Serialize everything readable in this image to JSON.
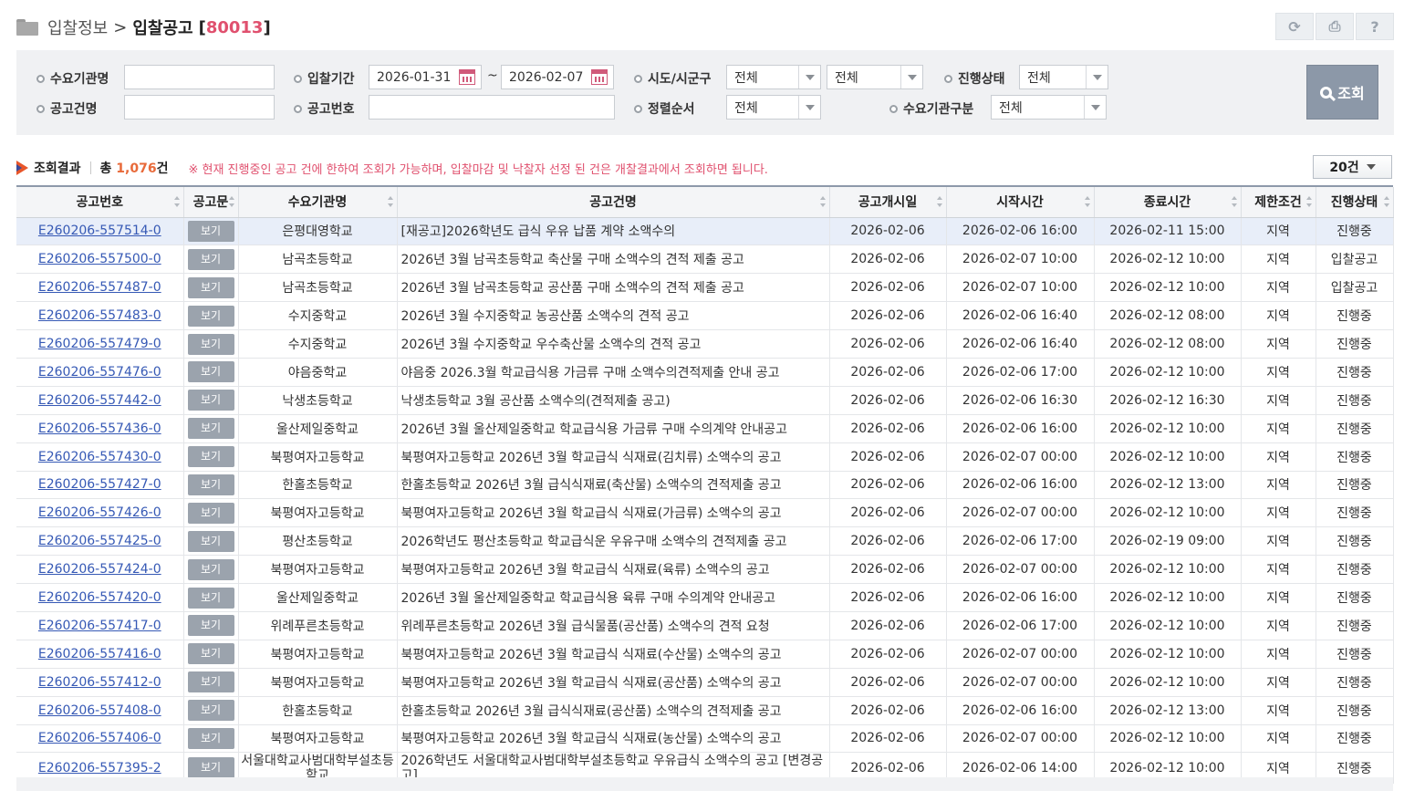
{
  "header": {
    "breadcrumb_parent": "입찰정보",
    "separator": ">",
    "title": "입찰공고",
    "code_prefix": "[",
    "code": "80013",
    "code_suffix": "]",
    "tools": [
      {
        "icon": "refresh-icon",
        "glyph": "⟳"
      },
      {
        "icon": "print-icon",
        "glyph": "⎙"
      },
      {
        "icon": "help-icon",
        "glyph": "?"
      }
    ]
  },
  "search": {
    "agency_label": "수요기관명",
    "agency_value": "",
    "title_label": "공고건명",
    "title_value": "",
    "period_label": "입찰기간",
    "date_from": "2026-01-31",
    "date_tilde": "~",
    "date_to": "2026-02-07",
    "notice_no_label": "공고번호",
    "notice_no_value": "",
    "region_label": "시도/시군구",
    "region_sido": "전체",
    "region_sigungu": "전체",
    "sort_label": "정렬순서",
    "sort_value": "전체",
    "status_label": "진행상태",
    "status_value": "전체",
    "agency_type_label": "수요기관구분",
    "agency_type_value": "전체",
    "search_button": "조회"
  },
  "result": {
    "title": "조회결과",
    "total_prefix": "총 ",
    "total_count": "1,076",
    "total_suffix": "건",
    "notice": "※ 현재 진행중인 공고 건에 한하여 조회가 가능하며, 입찰마감 및 낙찰자 선정 된 건은 개찰결과에서 조회하면 됩니다.",
    "page_size": "20건"
  },
  "table": {
    "headers": [
      "공고번호",
      "공고문",
      "수요기관명",
      "공고건명",
      "공고개시일",
      "시작시간",
      "종료시간",
      "제한조건",
      "진행상태"
    ],
    "view_label": "보기",
    "rows": [
      {
        "id": "E260206-557514-0",
        "agency": "은평대영학교",
        "title": "[재공고]2026학년도 급식 우유 납품 계약 소액수의",
        "open": "2026-02-06",
        "start": "2026-02-06 16:00",
        "end": "2026-02-11 15:00",
        "limit": "지역",
        "status": "진행중"
      },
      {
        "id": "E260206-557500-0",
        "agency": "남곡초등학교",
        "title": "2026년 3월 남곡초등학교 축산물 구매 소액수의 견적 제출 공고",
        "open": "2026-02-06",
        "start": "2026-02-07 10:00",
        "end": "2026-02-12 10:00",
        "limit": "지역",
        "status": "입찰공고"
      },
      {
        "id": "E260206-557487-0",
        "agency": "남곡초등학교",
        "title": "2026년 3월 남곡초등학교 공산품 구매 소액수의 견적 제출 공고",
        "open": "2026-02-06",
        "start": "2026-02-07 10:00",
        "end": "2026-02-12 10:00",
        "limit": "지역",
        "status": "입찰공고"
      },
      {
        "id": "E260206-557483-0",
        "agency": "수지중학교",
        "title": "2026년 3월 수지중학교 농공산품 소액수의 견적 공고",
        "open": "2026-02-06",
        "start": "2026-02-06 16:40",
        "end": "2026-02-12 08:00",
        "limit": "지역",
        "status": "진행중"
      },
      {
        "id": "E260206-557479-0",
        "agency": "수지중학교",
        "title": "2026년 3월 수지중학교 우수축산물 소액수의 견적 공고",
        "open": "2026-02-06",
        "start": "2026-02-06 16:40",
        "end": "2026-02-12 08:00",
        "limit": "지역",
        "status": "진행중"
      },
      {
        "id": "E260206-557476-0",
        "agency": "야음중학교",
        "title": "야음중 2026.3월 학교급식용 가금류 구매 소액수의견적제출 안내 공고",
        "open": "2026-02-06",
        "start": "2026-02-06 17:00",
        "end": "2026-02-12 10:00",
        "limit": "지역",
        "status": "진행중"
      },
      {
        "id": "E260206-557442-0",
        "agency": "낙생초등학교",
        "title": "낙생초등학교 3월 공산품 소액수의(견적제출 공고)",
        "open": "2026-02-06",
        "start": "2026-02-06 16:30",
        "end": "2026-02-12 16:30",
        "limit": "지역",
        "status": "진행중"
      },
      {
        "id": "E260206-557436-0",
        "agency": "울산제일중학교",
        "title": "2026년 3월 울산제일중학교 학교급식용 가금류 구매 수의계약 안내공고",
        "open": "2026-02-06",
        "start": "2026-02-06 16:00",
        "end": "2026-02-12 10:00",
        "limit": "지역",
        "status": "진행중"
      },
      {
        "id": "E260206-557430-0",
        "agency": "북평여자고등학교",
        "title": "북평여자고등학교 2026년 3월 학교급식 식재료(김치류) 소액수의 공고",
        "open": "2026-02-06",
        "start": "2026-02-07 00:00",
        "end": "2026-02-12 10:00",
        "limit": "지역",
        "status": "진행중"
      },
      {
        "id": "E260206-557427-0",
        "agency": "한홀초등학교",
        "title": "한홀초등학교 2026년 3월 급식식재료(축산물) 소액수의 견적제출 공고",
        "open": "2026-02-06",
        "start": "2026-02-06 16:00",
        "end": "2026-02-12 13:00",
        "limit": "지역",
        "status": "진행중"
      },
      {
        "id": "E260206-557426-0",
        "agency": "북평여자고등학교",
        "title": "북평여자고등학교 2026년 3월 학교급식 식재료(가금류) 소액수의 공고",
        "open": "2026-02-06",
        "start": "2026-02-07 00:00",
        "end": "2026-02-12 10:00",
        "limit": "지역",
        "status": "진행중"
      },
      {
        "id": "E260206-557425-0",
        "agency": "평산초등학교",
        "title": "2026학년도 평산초등학교 학교급식운 우유구매 소액수의 견적제출 공고",
        "open": "2026-02-06",
        "start": "2026-02-06 17:00",
        "end": "2026-02-19 09:00",
        "limit": "지역",
        "status": "진행중"
      },
      {
        "id": "E260206-557424-0",
        "agency": "북평여자고등학교",
        "title": "북평여자고등학교 2026년 3월 학교급식 식재료(육류) 소액수의 공고",
        "open": "2026-02-06",
        "start": "2026-02-07 00:00",
        "end": "2026-02-12 10:00",
        "limit": "지역",
        "status": "진행중"
      },
      {
        "id": "E260206-557420-0",
        "agency": "울산제일중학교",
        "title": "2026년 3월 울산제일중학교 학교급식용 육류 구매 수의계약 안내공고",
        "open": "2026-02-06",
        "start": "2026-02-06 16:00",
        "end": "2026-02-12 10:00",
        "limit": "지역",
        "status": "진행중"
      },
      {
        "id": "E260206-557417-0",
        "agency": "위례푸른초등학교",
        "title": "위례푸른초등학교 2026년 3월 급식물품(공산품) 소액수의 견적 요청",
        "open": "2026-02-06",
        "start": "2026-02-06 17:00",
        "end": "2026-02-12 10:00",
        "limit": "지역",
        "status": "진행중"
      },
      {
        "id": "E260206-557416-0",
        "agency": "북평여자고등학교",
        "title": "북평여자고등학교 2026년 3월 학교급식 식재료(수산물) 소액수의 공고",
        "open": "2026-02-06",
        "start": "2026-02-07 00:00",
        "end": "2026-02-12 10:00",
        "limit": "지역",
        "status": "진행중"
      },
      {
        "id": "E260206-557412-0",
        "agency": "북평여자고등학교",
        "title": "북평여자고등학교 2026년 3월 학교급식 식재료(공산품) 소액수의 공고",
        "open": "2026-02-06",
        "start": "2026-02-07 00:00",
        "end": "2026-02-12 10:00",
        "limit": "지역",
        "status": "진행중"
      },
      {
        "id": "E260206-557408-0",
        "agency": "한홀초등학교",
        "title": "한홀초등학교 2026년 3월 급식식재료(공산품) 소액수의 견적제출 공고",
        "open": "2026-02-06",
        "start": "2026-02-06 16:00",
        "end": "2026-02-12 13:00",
        "limit": "지역",
        "status": "진행중"
      },
      {
        "id": "E260206-557406-0",
        "agency": "북평여자고등학교",
        "title": "북평여자고등학교 2026년 3월 학교급식 식재료(농산물) 소액수의 공고",
        "open": "2026-02-06",
        "start": "2026-02-07 00:00",
        "end": "2026-02-12 10:00",
        "limit": "지역",
        "status": "진행중"
      },
      {
        "id": "E260206-557395-2",
        "agency": "서울대학교사범대학부설초등학교",
        "title": "2026학년도 서울대학교사범대학부설초등학교 우유급식 소액수의 공고 [변경공고]",
        "open": "2026-02-06",
        "start": "2026-02-06 14:00",
        "end": "2026-02-12 10:00",
        "limit": "지역",
        "status": "진행중"
      }
    ]
  }
}
